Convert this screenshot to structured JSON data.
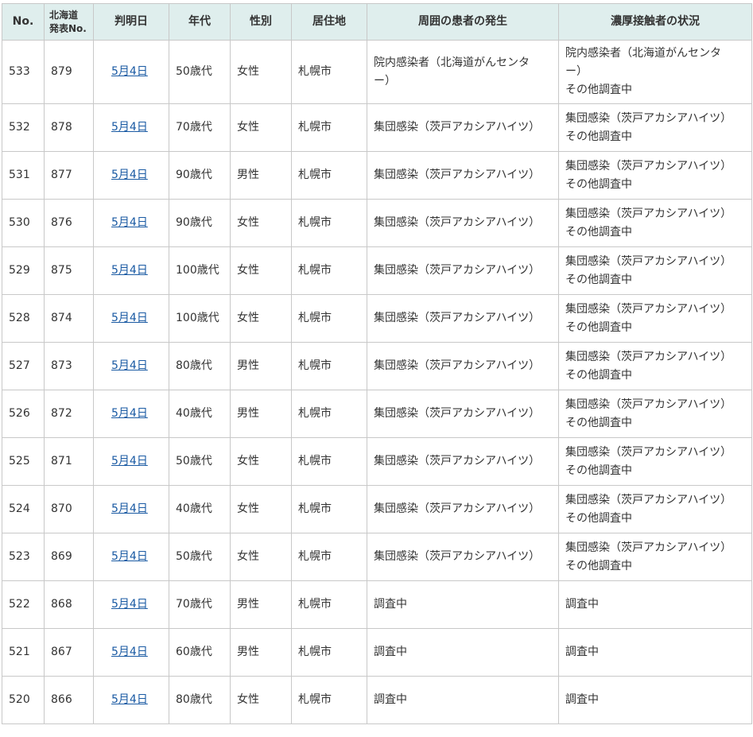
{
  "headers": {
    "no": "No.",
    "hokkaido_no_line1": "北海道",
    "hokkaido_no_line2": "発表No.",
    "date": "判明日",
    "age": "年代",
    "sex": "性別",
    "residence": "居住地",
    "surrounding": "周囲の患者の発生",
    "contacts": "濃厚接触者の状況"
  },
  "rows": [
    {
      "no": "533",
      "hno": "879",
      "date": "5月4日",
      "age": "50歳代",
      "sex": "女性",
      "residence": "札幌市",
      "surrounding_1": "院内感染者（北海道がんセンタ",
      "surrounding_2": "ー）",
      "contacts_1": "院内感染者（北海道がんセンタ",
      "contacts_2": "ー）",
      "contacts_3": "その他調査中"
    },
    {
      "no": "532",
      "hno": "878",
      "date": "5月4日",
      "age": "70歳代",
      "sex": "女性",
      "residence": "札幌市",
      "surrounding_1": "集団感染（茨戸アカシアハイツ）",
      "contacts_1": "集団感染（茨戸アカシアハイツ）",
      "contacts_2": "その他調査中"
    },
    {
      "no": "531",
      "hno": "877",
      "date": "5月4日",
      "age": "90歳代",
      "sex": "男性",
      "residence": "札幌市",
      "surrounding_1": "集団感染（茨戸アカシアハイツ）",
      "contacts_1": "集団感染（茨戸アカシアハイツ）",
      "contacts_2": "その他調査中"
    },
    {
      "no": "530",
      "hno": "876",
      "date": "5月4日",
      "age": "90歳代",
      "sex": "女性",
      "residence": "札幌市",
      "surrounding_1": "集団感染（茨戸アカシアハイツ）",
      "contacts_1": "集団感染（茨戸アカシアハイツ）",
      "contacts_2": "その他調査中"
    },
    {
      "no": "529",
      "hno": "875",
      "date": "5月4日",
      "age": "100歳代",
      "sex": "女性",
      "residence": "札幌市",
      "surrounding_1": "集団感染（茨戸アカシアハイツ）",
      "contacts_1": "集団感染（茨戸アカシアハイツ）",
      "contacts_2": "その他調査中"
    },
    {
      "no": "528",
      "hno": "874",
      "date": "5月4日",
      "age": "100歳代",
      "sex": "女性",
      "residence": "札幌市",
      "surrounding_1": "集団感染（茨戸アカシアハイツ）",
      "contacts_1": "集団感染（茨戸アカシアハイツ）",
      "contacts_2": "その他調査中"
    },
    {
      "no": "527",
      "hno": "873",
      "date": "5月4日",
      "age": "80歳代",
      "sex": "男性",
      "residence": "札幌市",
      "surrounding_1": "集団感染（茨戸アカシアハイツ）",
      "contacts_1": "集団感染（茨戸アカシアハイツ）",
      "contacts_2": "その他調査中"
    },
    {
      "no": "526",
      "hno": "872",
      "date": "5月4日",
      "age": "40歳代",
      "sex": "男性",
      "residence": "札幌市",
      "surrounding_1": "集団感染（茨戸アカシアハイツ）",
      "contacts_1": "集団感染（茨戸アカシアハイツ）",
      "contacts_2": "その他調査中"
    },
    {
      "no": "525",
      "hno": "871",
      "date": "5月4日",
      "age": "50歳代",
      "sex": "女性",
      "residence": "札幌市",
      "surrounding_1": "集団感染（茨戸アカシアハイツ）",
      "contacts_1": "集団感染（茨戸アカシアハイツ）",
      "contacts_2": "その他調査中"
    },
    {
      "no": "524",
      "hno": "870",
      "date": "5月4日",
      "age": "40歳代",
      "sex": "女性",
      "residence": "札幌市",
      "surrounding_1": "集団感染（茨戸アカシアハイツ）",
      "contacts_1": "集団感染（茨戸アカシアハイツ）",
      "contacts_2": "その他調査中"
    },
    {
      "no": "523",
      "hno": "869",
      "date": "5月4日",
      "age": "50歳代",
      "sex": "女性",
      "residence": "札幌市",
      "surrounding_1": "集団感染（茨戸アカシアハイツ）",
      "contacts_1": "集団感染（茨戸アカシアハイツ）",
      "contacts_2": "その他調査中"
    },
    {
      "no": "522",
      "hno": "868",
      "date": "5月4日",
      "age": "70歳代",
      "sex": "男性",
      "residence": "札幌市",
      "surrounding_1": "調査中",
      "contacts_1": "調査中"
    },
    {
      "no": "521",
      "hno": "867",
      "date": "5月4日",
      "age": "60歳代",
      "sex": "男性",
      "residence": "札幌市",
      "surrounding_1": "調査中",
      "contacts_1": "調査中"
    },
    {
      "no": "520",
      "hno": "866",
      "date": "5月4日",
      "age": "80歳代",
      "sex": "女性",
      "residence": "札幌市",
      "surrounding_1": "調査中",
      "contacts_1": "調査中"
    }
  ],
  "colors": {
    "header_bg": "#dfeeed",
    "border": "#c8c8c8",
    "link": "#1a5aa3"
  }
}
